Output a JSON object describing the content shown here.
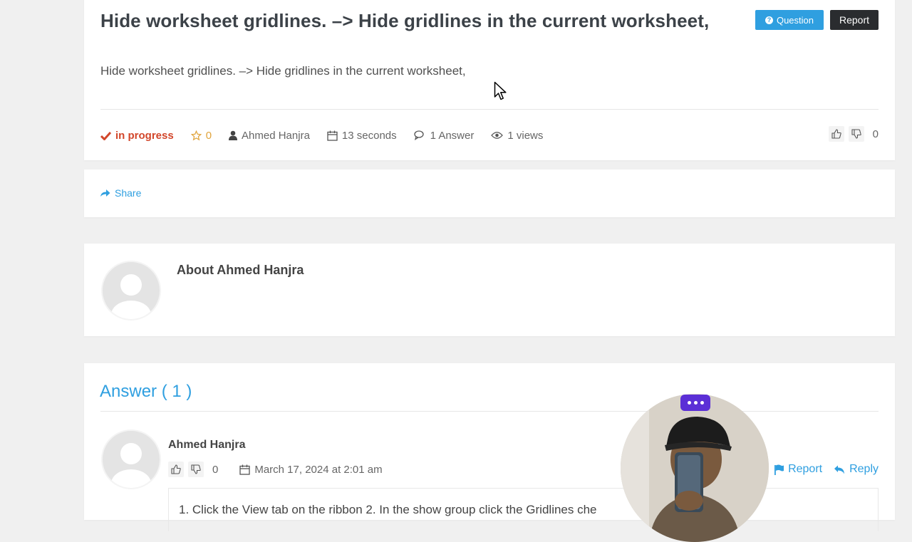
{
  "question": {
    "title": "Hide worksheet gridlines. –> Hide gridlines in the current worksheet,",
    "body": "Hide worksheet gridlines. –> Hide gridlines in the current worksheet,",
    "type_badge": "Question",
    "report_label": "Report",
    "meta": {
      "status": "in progress",
      "favorites": "0",
      "author": "Ahmed Hanjra",
      "time": "13 seconds",
      "answers": "1 Answer",
      "views": "1 views"
    },
    "votes": "0"
  },
  "share": {
    "label": "Share"
  },
  "about": {
    "title": "About Ahmed Hanjra"
  },
  "answers_section": {
    "title": "Answer ( 1 )",
    "items": [
      {
        "author": "Ahmed Hanjra",
        "votes": "0",
        "date": "March 17, 2024 at 2:01 am",
        "report_label": "Report",
        "reply_label": "Reply",
        "text": "1. Click the View tab on the ribbon 2. In the show group click the Gridlines che"
      }
    ]
  },
  "colors": {
    "accent": "#2f9fe0",
    "status": "#d2462a",
    "star": "#e0a43c",
    "report_badge": "#2a2c2f",
    "overlay_menu": "#5b2fd6"
  }
}
